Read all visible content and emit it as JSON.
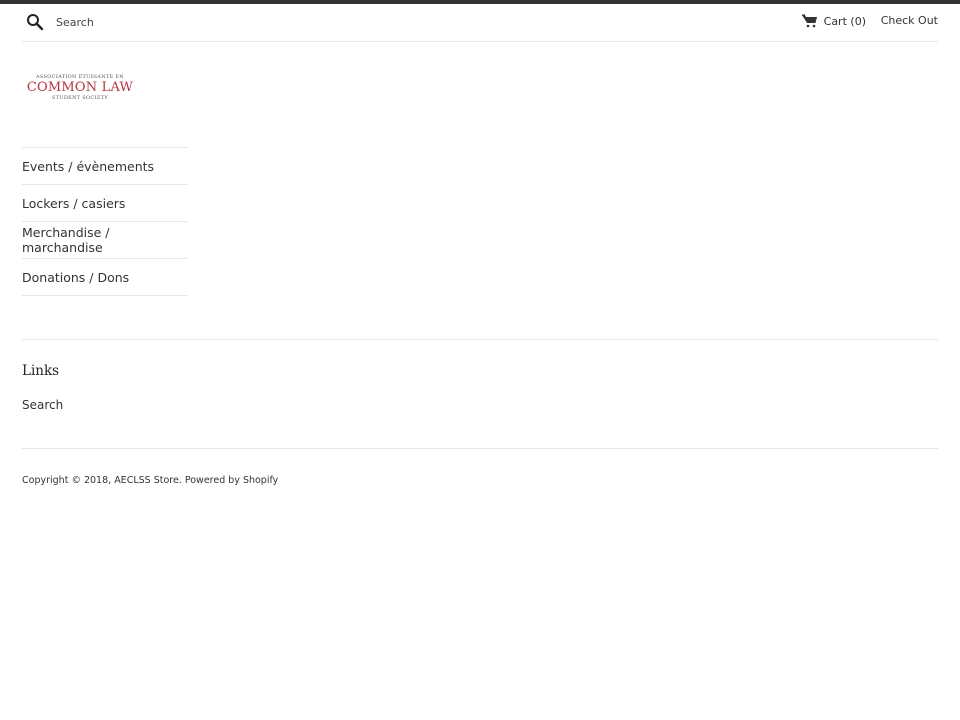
{
  "header": {
    "search_placeholder": "Search",
    "search_value": "",
    "cart_label": "Cart",
    "cart_count": "(0)",
    "checkout_label": "Check Out"
  },
  "logo": {
    "line1": "ASSOCIATION ÉTUDIANTE EN",
    "line2": "COMMON LAW",
    "line3": "STUDENT SOCIETY",
    "brand_color": "#b5343f"
  },
  "nav": {
    "items": [
      {
        "label": "Events / évènements"
      },
      {
        "label": "Lockers / casiers"
      },
      {
        "label": "Merchandise / marchandise"
      },
      {
        "label": "Donations / Dons"
      }
    ]
  },
  "footer": {
    "links_heading": "Links",
    "links": [
      {
        "label": "Search"
      }
    ],
    "copyright_prefix": "Copyright © 2018, ",
    "store_name": "AECLSS Store",
    "separator": ". ",
    "powered_by": "Powered by Shopify"
  }
}
